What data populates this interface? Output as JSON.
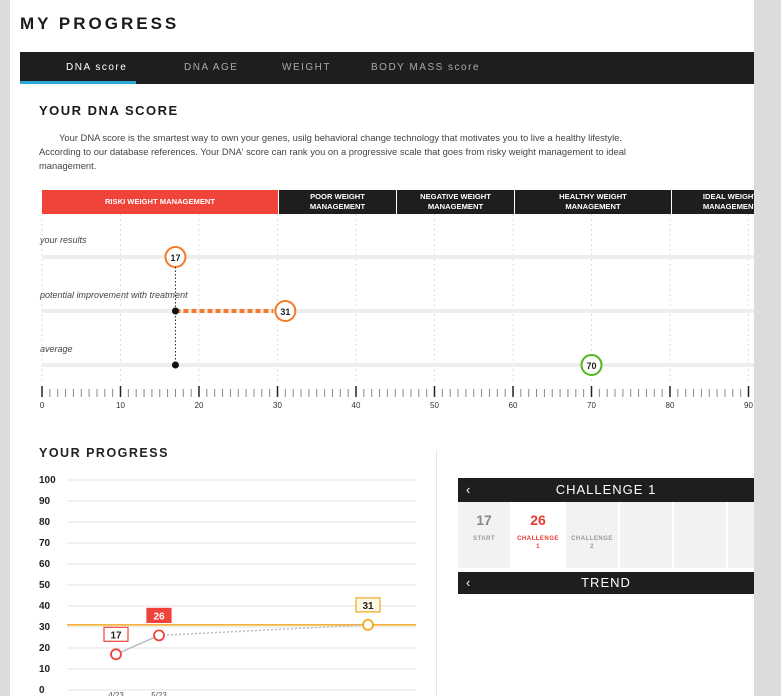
{
  "page_title": "MY PROGRESS",
  "tabs": [
    {
      "label": "DNA score",
      "active": true
    },
    {
      "label": "DNA AGE",
      "active": false
    },
    {
      "label": "WEIGHT",
      "active": false
    },
    {
      "label": "BODY MASS score",
      "active": false
    }
  ],
  "dna_score": {
    "title": "YOUR  DNA SCORE",
    "description_line1": "Your DNA score is the smartest way to own your genes, usilg behavioral change technology that motivates you to live a healthy lifestyle.",
    "description_line2": "According to our database references.       Your DNA' score can rank you on a progressive scale that goes from risky weight management to ideal",
    "description_line3": "management.",
    "categories": [
      {
        "line1": "RISKI WEIGHT MANAGEMENT",
        "line2": ""
      },
      {
        "line1": "POOR WEIGHT",
        "line2": "MANAGEMENT"
      },
      {
        "line1": "NEGATIVE WEIGHT",
        "line2": "MANAGEMENT"
      },
      {
        "line1": "HEALTHY WEIGHT",
        "line2": "MANAGEMENT"
      },
      {
        "line1": "IDEAL WEIGHT",
        "line2": "MANAGEMENT"
      }
    ],
    "rows": [
      {
        "label": "your results",
        "value": 17,
        "display": "17"
      },
      {
        "label": "potential improvement with treatment",
        "from": 17,
        "value": 31,
        "display": "31"
      },
      {
        "label": "average",
        "from": 17,
        "value": 70,
        "display": "70"
      }
    ],
    "scale_ticks": [
      "0",
      "10",
      "20",
      "30",
      "40",
      "50",
      "60",
      "70",
      "80",
      "90"
    ],
    "colors": {
      "red": "#f0433a",
      "orange": "#f5792a",
      "yellow": "#e8d21a",
      "green": "#4fb81c",
      "dark": "#1e1e1e"
    }
  },
  "progress": {
    "title": "YOUR PROGRESS",
    "chart_data": {
      "type": "line",
      "y_ticks": [
        "100",
        "90",
        "80",
        "70",
        "60",
        "50",
        "40",
        "30",
        "20",
        "10",
        "0"
      ],
      "ylim": [
        0,
        100
      ],
      "target_line": 31,
      "x_labels": [
        "4/23",
        "5/23"
      ],
      "points": [
        {
          "x": 0,
          "y": 17,
          "label": "17"
        },
        {
          "x": 1,
          "y": 26,
          "label": "26"
        },
        {
          "x": 5,
          "y": 31,
          "label": "31"
        }
      ],
      "colors": {
        "line": "#bbbbbb",
        "point": "#f0433a",
        "target": "#f5a623"
      }
    }
  },
  "challenge": {
    "title": "CHALLENGE 1",
    "prev_icon": "chevron-left-icon",
    "cells": [
      {
        "value": "17",
        "caption1": "START",
        "caption2": "",
        "active": false
      },
      {
        "value": "26",
        "caption1": "CHALLENGE",
        "caption2": "1",
        "active": true
      },
      {
        "value": "",
        "caption1": "CHALLENGE",
        "caption2": "2",
        "active": false
      },
      {
        "value": "",
        "caption1": "",
        "caption2": "",
        "active": false
      },
      {
        "value": "",
        "caption1": "",
        "caption2": "",
        "active": false
      },
      {
        "value": "",
        "caption1": "",
        "caption2": "",
        "active": false
      }
    ],
    "trend_label": "TREND"
  }
}
